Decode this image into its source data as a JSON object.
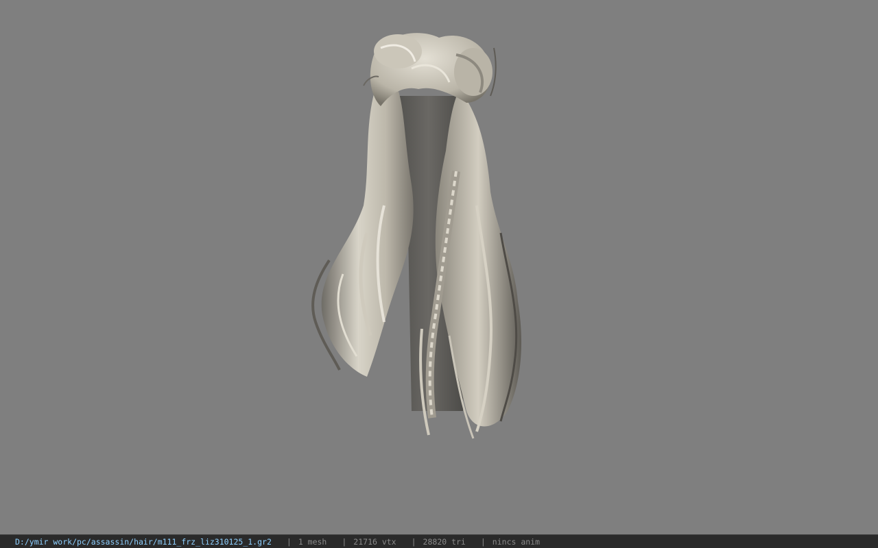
{
  "viewport": {
    "background": "#7f7f7f",
    "model": "hair-mesh"
  },
  "statusbar": {
    "file_path": "D:/ymir work/pc/assassin/hair/m111_frz_liz310125_1.gr2",
    "separator": "|",
    "mesh_count": "1 mesh",
    "vertex_count": "21716 vtx",
    "triangle_count": "28820 tri",
    "anim_status": "nincs anim",
    "path_color": "#8fd0ff",
    "info_color": "#8a8a8a"
  }
}
